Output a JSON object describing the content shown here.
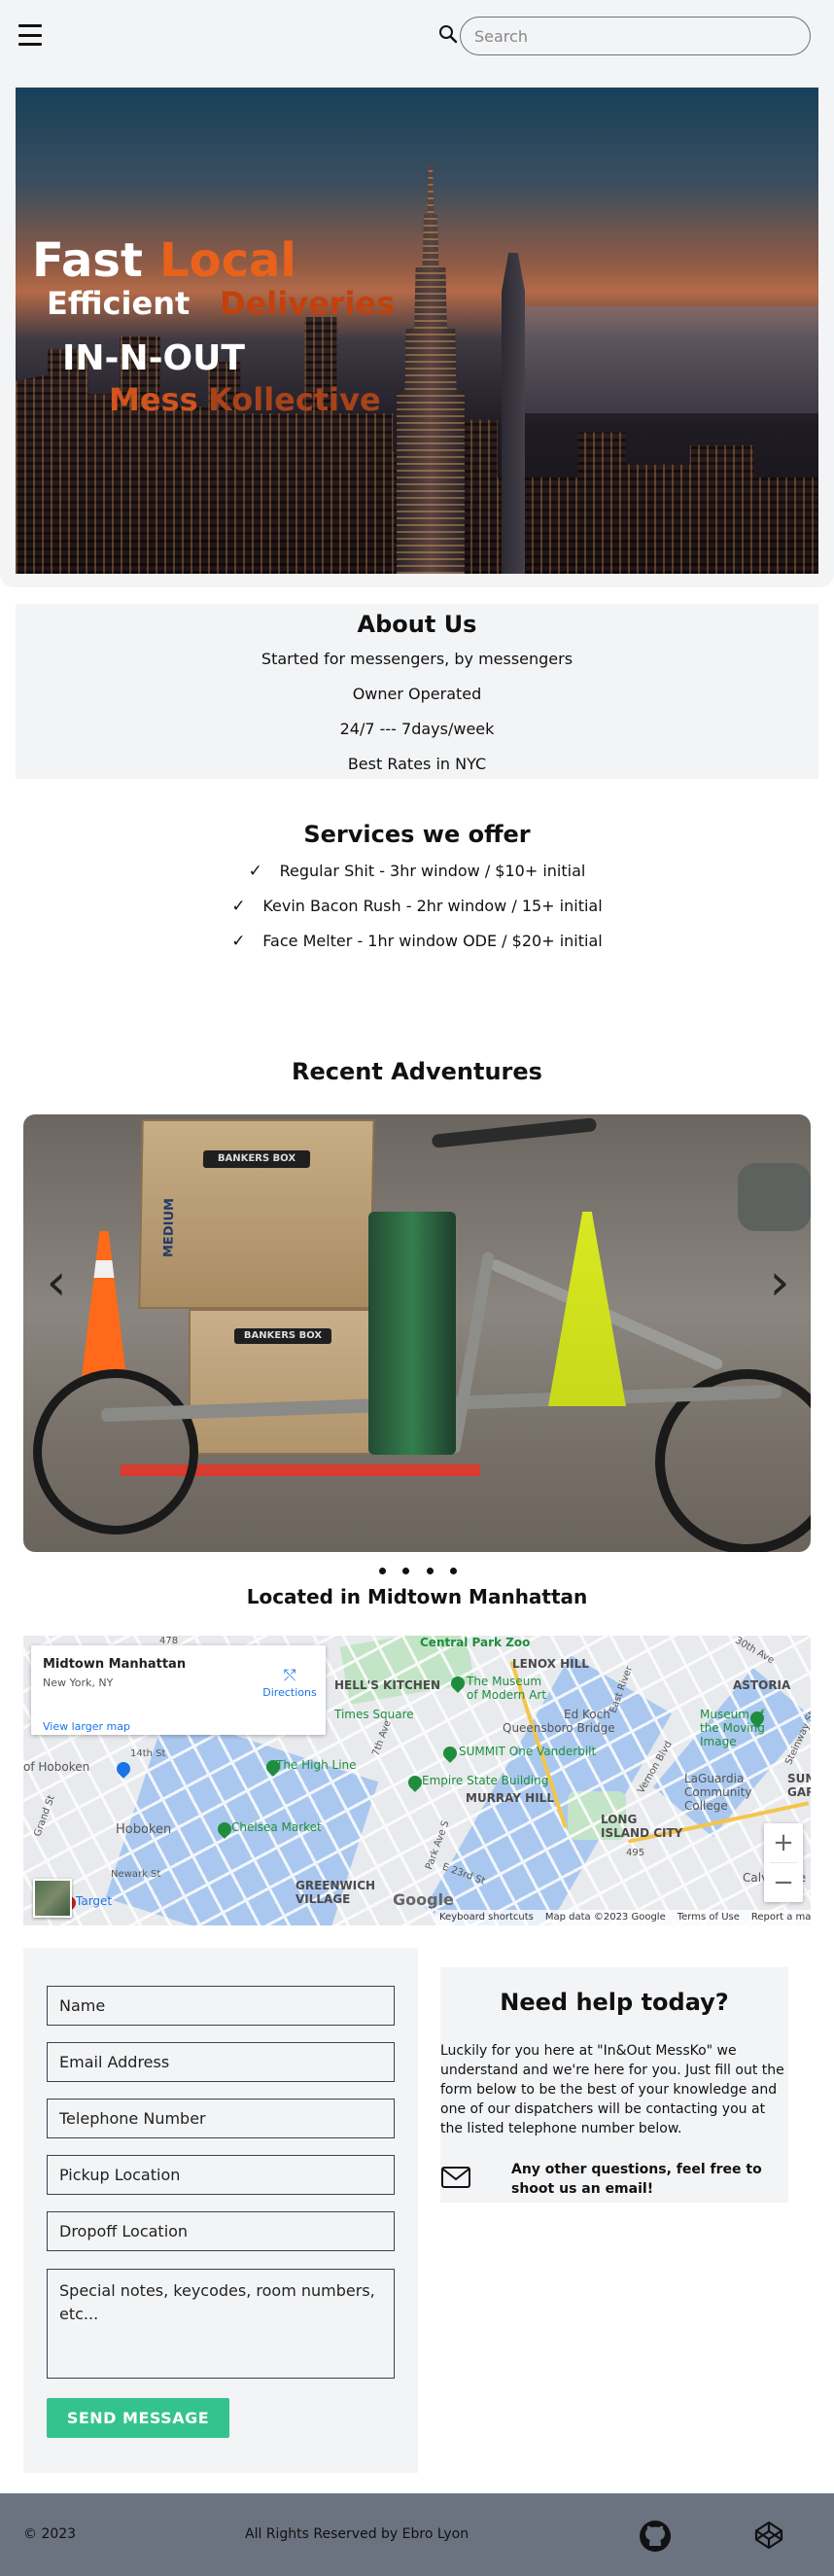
{
  "header": {
    "search_placeholder": "Search",
    "menu_icon": "hamburger-menu-icon",
    "search_icon": "search-icon"
  },
  "hero": {
    "line1_a": "Fast",
    "line1_b": "Local",
    "line2_a": "Efficient",
    "line2_b": "Deliveries",
    "line3": "IN-N-OUT",
    "line4_a": "Mess",
    "line4_b": "Kollective"
  },
  "about": {
    "title": "About Us",
    "lines": [
      "Started for messengers, by messengers",
      "Owner Operated",
      "24/7 --- 7days/week",
      "Best Rates in NYC"
    ]
  },
  "services": {
    "title": "Services we offer",
    "check": "✓",
    "items": [
      "Regular Shit - 3hr window / $10+ initial",
      "Kevin Bacon Rush - 2hr window / 15+ initial",
      "Face Melter - 1hr window ODE / $20+ initial"
    ]
  },
  "adventures": {
    "title": "Recent Adventures",
    "box_label_1": "BANKERS BOX",
    "box_label_2": "MEDIUM",
    "box_label_3": "BANKERS BOX",
    "prev": "‹",
    "next": "›",
    "slide_count": 4,
    "active_slide": 1
  },
  "location": {
    "title": "Located in Midtown Manhattan",
    "map": {
      "place_name": "Midtown Manhattan",
      "place_sub": "New York, NY",
      "directions": "Directions",
      "larger_map": "View larger map",
      "zoom_in": "+",
      "zoom_out": "−",
      "google": "Google",
      "footer": [
        "Keyboard shortcuts",
        "Map data ©2023 Google",
        "Terms of Use",
        "Report a map error"
      ],
      "labels": {
        "central_park_zoo": "Central Park Zoo",
        "lenox_hill": "LENOX HILL",
        "astoria": "ASTORIA",
        "hells_kitchen": "HELL'S KITCHEN",
        "moma": "The Museum of Modern Art",
        "ed_koch": "Ed Koch",
        "queensboro": "Queensboro Bridge",
        "museum_moving_image": "Museum of the Moving Image",
        "times_square": "Times Square",
        "one_vanderbilt": "SUMMIT One Vanderbilt",
        "hoboken_terminal": "of Hoboken",
        "high_line": "The High Line",
        "esb": "Empire State Building",
        "murray_hill": "MURRAY HILL",
        "laguardia": "LaGuardia Community College",
        "hoboken": "Hoboken",
        "chelsea_market": "Chelsea Market",
        "long_island_city": "LONG ISLAND CITY",
        "sunny": "SUNNY",
        "gard": "GARD",
        "greenwich_village": "GREENWICH VILLAGE",
        "target": "Target",
        "calvary": "Calvary Ce",
        "east_river": "East River",
        "ave_7th": "7th Ave",
        "ave_park": "Park Ave S",
        "st_23rd": "E 23rd St",
        "st_14th": "14th St",
        "newark": "Newark St",
        "st_30th": "30th Ave",
        "vernon": "Vernon Blvd",
        "hwy_495": "495",
        "hwy_478": "478",
        "steinway": "Steinway St",
        "grand": "Grand St"
      }
    }
  },
  "contact": {
    "fields": {
      "name": "Name",
      "email": "Email Address",
      "phone": "Telephone Number",
      "pickup": "Pickup Location",
      "dropoff": "Dropoff Location",
      "notes": "Special notes, keycodes, room numbers, etc..."
    },
    "submit": "SEND MESSAGE",
    "help_title": "Need help today?",
    "help_text": "Luckily for you here at \"In&Out MessKo\" we understand and we're here for you. Just fill out the form below to be the best of your knowledge and one of our dispatchers will be contacting you at the listed telephone number below.",
    "email_note": "Any other questions, feel free to shoot us an email!",
    "mail_icon": "envelope-icon"
  },
  "footer": {
    "copyright": "© 2023",
    "rights": "All Rights Reserved by Ebro Lyon",
    "github_icon": "github-icon",
    "codepen_icon": "codepen-icon"
  },
  "colors": {
    "accent_orange": "#e8621c",
    "send_button": "#34c38f",
    "footer_bg": "#6b7280",
    "panel_bg": "#f3f4f6",
    "link_blue": "#1a73e8"
  }
}
